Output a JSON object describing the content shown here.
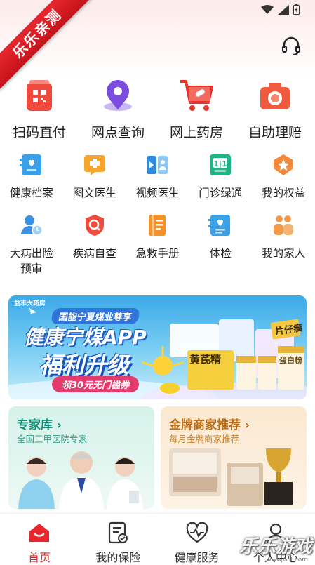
{
  "ribbon": {
    "text": "乐乐亲测"
  },
  "quick_services": [
    {
      "label": "扫码直付",
      "icon": "qr-scan-icon"
    },
    {
      "label": "网点查询",
      "icon": "location-pin-icon"
    },
    {
      "label": "网上药房",
      "icon": "shopping-cart-icon"
    },
    {
      "label": "自助理赔",
      "icon": "camera-icon"
    }
  ],
  "services_row1": [
    {
      "label": "健康档案",
      "icon": "health-record-icon"
    },
    {
      "label": "图文医生",
      "icon": "chat-doctor-icon"
    },
    {
      "label": "视频医生",
      "icon": "video-doctor-icon"
    },
    {
      "label": "门诊绿通",
      "icon": "clinic-green-channel-icon"
    },
    {
      "label": "我的权益",
      "icon": "rights-badge-icon"
    }
  ],
  "services_row2": [
    {
      "label": "大病出险",
      "label2": "预审",
      "icon": "serious-illness-icon"
    },
    {
      "label": "疾病自查",
      "icon": "disease-check-icon"
    },
    {
      "label": "急救手册",
      "icon": "first-aid-manual-icon"
    },
    {
      "label": "体检",
      "icon": "checkup-icon"
    },
    {
      "label": "我的家人",
      "icon": "family-icon"
    }
  ],
  "banner": {
    "logo": "益丰大药房",
    "slogan": "国能宁夏煤业尊享",
    "title": "健康宁煤APP",
    "subtitle": "福利升级",
    "coupon": "领30元无门槛券",
    "product1": "黄芪精",
    "product2": "蛋白粉",
    "product3": "片仔癀"
  },
  "cards": {
    "experts": {
      "title": "专家库",
      "subtitle": "全国三甲医院专家"
    },
    "merchants": {
      "title": "金牌商家推荐",
      "subtitle": "每月金牌商家推荐"
    }
  },
  "tabs": [
    {
      "label": "首页",
      "icon": "home-icon",
      "active": true
    },
    {
      "label": "我的保险",
      "icon": "insurance-doc-icon",
      "active": false
    },
    {
      "label": "健康服务",
      "icon": "heart-pulse-icon",
      "active": false
    },
    {
      "label": "个人中心",
      "icon": "person-icon",
      "active": false
    }
  ],
  "watermark": {
    "text": "乐乐游戏",
    "url": "www.6lll.com"
  },
  "colors": {
    "brand_red": "#e02a2a",
    "expert_green": "#0f8f76",
    "merchant_gold": "#b96a12"
  }
}
